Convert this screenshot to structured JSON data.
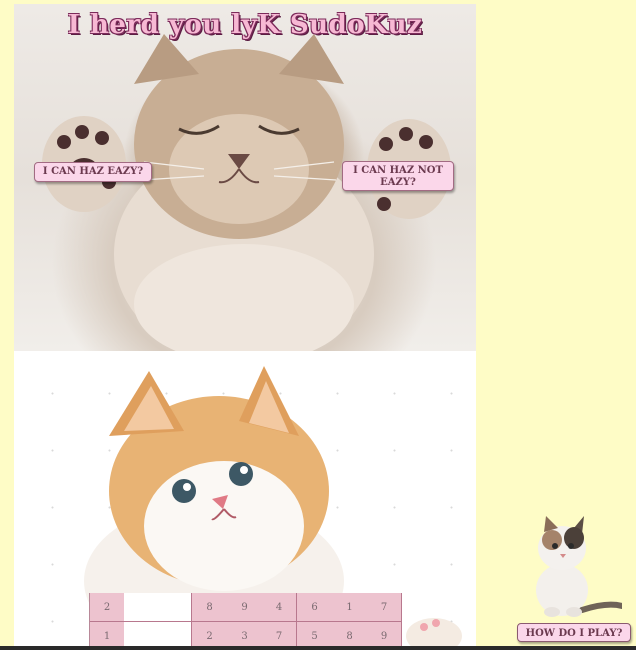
{
  "header": {
    "title": "I herd you lyK SudoKuz"
  },
  "buttons": {
    "easy_label": "I CAN HAZ EAZY?",
    "hard_label": "I CAN HAZ NOT EAZY?",
    "help_label": "HOW DO I PLAY?"
  },
  "images": {
    "hero": "sleeping-kitten-photo",
    "lower": "fluffy-kitten-photo",
    "mini": "calico-kitten-photo"
  },
  "colors": {
    "page_bg": "#fefcc6",
    "button_bg": "#fbd7ea",
    "cell_bg": "#edc3cf",
    "title_fill": "#f7b9d4",
    "title_outline": "#7c2a5a"
  },
  "sudoku": {
    "rows": [
      [
        "2",
        "",
        "",
        "8",
        "9",
        "4",
        "6",
        "1",
        "7"
      ],
      [
        "1",
        "",
        "",
        "2",
        "3",
        "7",
        "5",
        "8",
        "9"
      ]
    ]
  }
}
